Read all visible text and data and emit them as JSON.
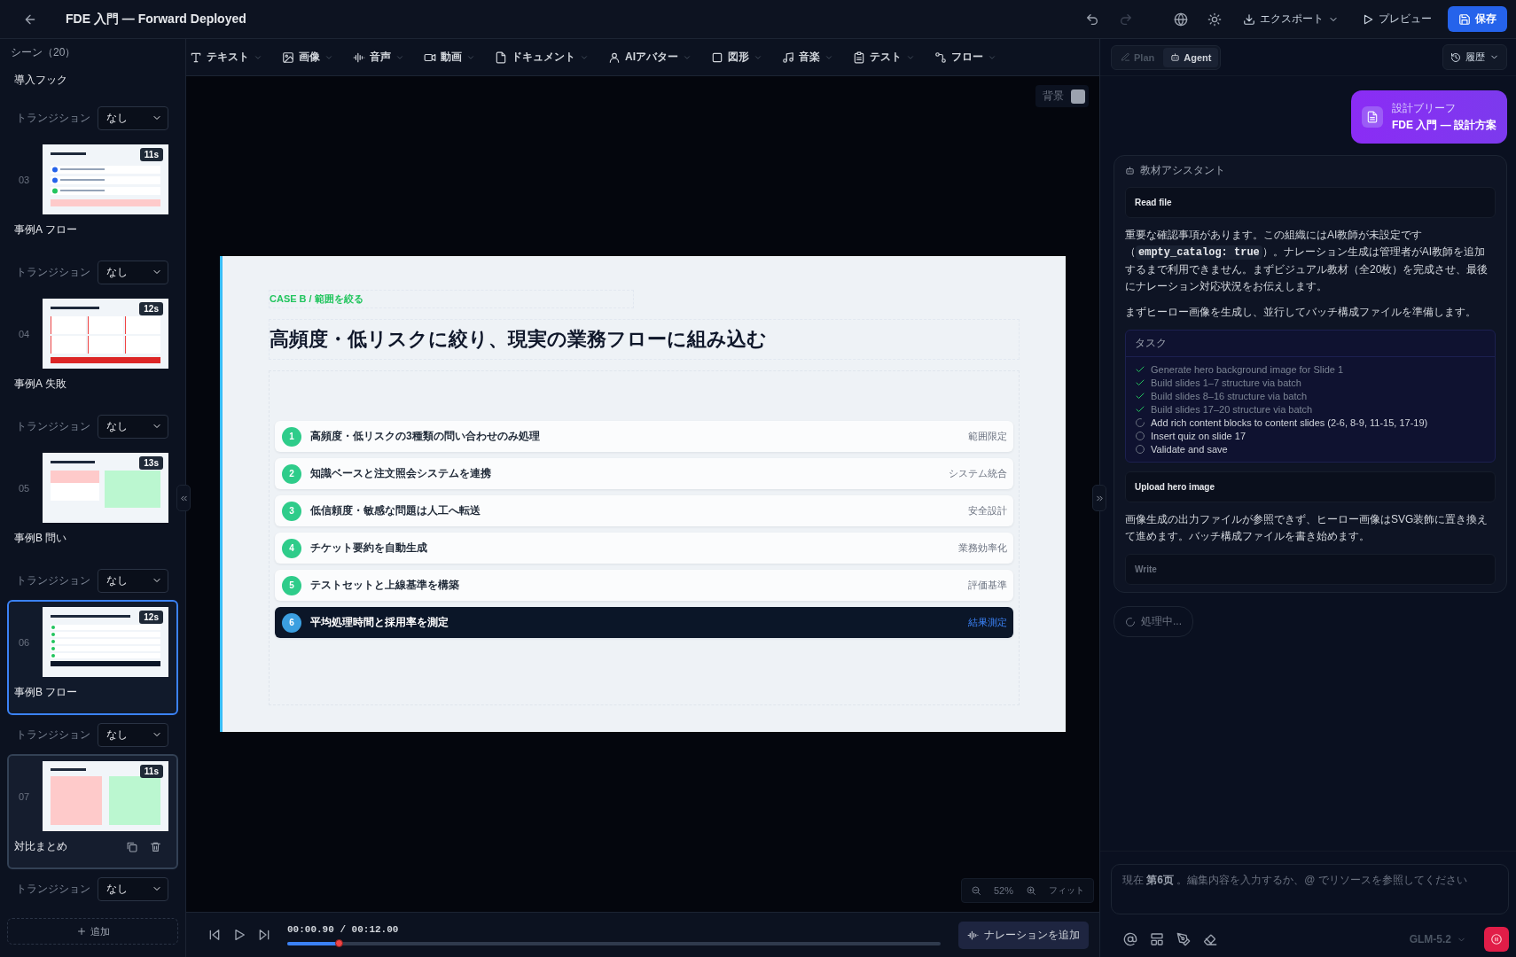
{
  "window": {
    "title": "FDE 入門 — Forward Deployed"
  },
  "header": {
    "undo": {
      "disabled": false
    },
    "redo": {
      "disabled": true
    },
    "export": "エクスポート",
    "preview": "プレビュー",
    "save": "保存"
  },
  "toolbar": [
    {
      "kind": "text",
      "label": "テキスト"
    },
    {
      "kind": "image",
      "label": "画像"
    },
    {
      "kind": "audio",
      "label": "音声"
    },
    {
      "kind": "video",
      "label": "動画"
    },
    {
      "kind": "document",
      "label": "ドキュメント"
    },
    {
      "kind": "avatar",
      "label": "AIアバター"
    },
    {
      "kind": "shape",
      "label": "図形"
    },
    {
      "kind": "music",
      "label": "音楽"
    },
    {
      "kind": "test",
      "label": "テスト"
    },
    {
      "kind": "flow",
      "label": "フロー"
    }
  ],
  "scenes": {
    "title": "シーン（20）",
    "add_button": "追加",
    "items": [
      {
        "name": "導入フック",
        "transition": {
          "label": "トランジション",
          "value": "なし"
        }
      },
      {
        "number": "03",
        "duration": "11s",
        "thumbnail": {
          "kind": "list"
        },
        "name": "事例A フロー",
        "selected": false,
        "hovered": false,
        "transition": {
          "label": "トランジション",
          "value": "なし"
        }
      },
      {
        "number": "04",
        "duration": "12s",
        "thumbnail": {
          "kind": "grid"
        },
        "name": "事例A 失敗",
        "selected": false,
        "hovered": false,
        "transition": {
          "label": "トランジション",
          "value": "なし"
        }
      },
      {
        "number": "05",
        "duration": "13s",
        "thumbnail": {
          "kind": "columns"
        },
        "name": "事例B 問い",
        "selected": false,
        "hovered": false,
        "transition": {
          "label": "トランジション",
          "value": "なし"
        }
      },
      {
        "number": "06",
        "duration": "12s",
        "thumbnail": {
          "kind": "steps"
        },
        "name": "事例B フロー",
        "selected": true,
        "hovered": false,
        "transition": {
          "label": "トランジション",
          "value": "なし"
        }
      },
      {
        "number": "07",
        "duration": "11s",
        "thumbnail": {
          "kind": "compare"
        },
        "name": "対比まとめ",
        "selected": false,
        "hovered": true,
        "transition": {
          "label": "トランジション",
          "value": "なし"
        }
      }
    ]
  },
  "canvas": {
    "background_label": "背景",
    "zoom": "52%",
    "fit": "フィット"
  },
  "slide": {
    "eyebrow": "CASE B / 範囲を絞る",
    "title": "高頻度・低リスクに絞り、現実の業務フローに組み込む",
    "steps": [
      {
        "number": "1",
        "text": "高頻度・低リスクの3種類の問い合わせのみ処理",
        "tag": "範囲限定",
        "selected": false
      },
      {
        "number": "2",
        "text": "知識ベースと注文照会システムを連携",
        "tag": "システム統合",
        "selected": false
      },
      {
        "number": "3",
        "text": "低信頼度・敏感な問題は人工へ転送",
        "tag": "安全設計",
        "selected": false
      },
      {
        "number": "4",
        "text": "チケット要約を自動生成",
        "tag": "業務効率化",
        "selected": false
      },
      {
        "number": "5",
        "text": "テストセットと上線基準を構築",
        "tag": "評価基準",
        "selected": false
      },
      {
        "number": "6",
        "text": "平均処理時間と採用率を測定",
        "tag": "結果測定",
        "selected": true
      }
    ]
  },
  "playback": {
    "time": "00:00.90 / 00:12.00",
    "level": 0.08,
    "narration_button": "ナレーションを追加"
  },
  "agent": {
    "modes": [
      {
        "label": "Plan",
        "selected": false
      },
      {
        "label": "Agent",
        "selected": true
      }
    ],
    "history_button": "履歴",
    "brief": {
      "caption": "設計ブリーフ",
      "title": "FDE 入門 — 設計方案"
    },
    "assistant": {
      "name": "教材アシスタント",
      "messages": [
        {
          "kind": "tool",
          "label": "Read file",
          "active": true
        },
        {
          "kind": "text",
          "parts": [
            {
              "text": "重要な確認事項があります。この組織にはAI教師が未設定です（",
              "code": false
            },
            {
              "text": "empty_catalog: true",
              "code": true
            },
            {
              "text": "）。ナレーション生成は管理者がAI教師を追加するまで利用できません。まずビジュアル教材（全20枚）を完成させ、最後にナレーション対応状況をお伝えします。",
              "code": false
            }
          ]
        },
        {
          "kind": "text",
          "parts": [
            {
              "text": "まずヒーロー画像を生成し、並行してバッチ構成ファイルを準備します。",
              "code": false
            }
          ]
        },
        {
          "kind": "tasks",
          "title": "タスク",
          "items": [
            {
              "text": "Generate hero background image for Slide 1",
              "done": true,
              "running": false
            },
            {
              "text": "Build slides 1–7 structure via batch",
              "done": true,
              "running": false
            },
            {
              "text": "Build slides 8–16 structure via batch",
              "done": true,
              "running": false
            },
            {
              "text": "Build slides 17–20 structure via batch",
              "done": true,
              "running": false
            },
            {
              "text": "Add rich content blocks to content slides (2-6, 8-9, 11-15, 17-19)",
              "done": false,
              "running": true
            },
            {
              "text": "Insert quiz on slide 17",
              "done": false,
              "running": false
            },
            {
              "text": "Validate and save",
              "done": false,
              "running": false
            }
          ]
        },
        {
          "kind": "tool",
          "label": "Upload hero image",
          "active": true
        },
        {
          "kind": "text",
          "parts": [
            {
              "text": "画像生成の出力ファイルが参照できず、ヒーロー画像はSVG装飾に置き換えて進めます。バッチ構成ファイルを書き始めます。",
              "code": false
            }
          ]
        },
        {
          "kind": "tool",
          "label": "Write",
          "active": false
        }
      ]
    },
    "status": "処理中...",
    "input": {
      "placeholder": "現在 **第6页** 。編集内容を入力するか、@ でリソースを参照してください"
    },
    "model": "GLM-5.2"
  }
}
